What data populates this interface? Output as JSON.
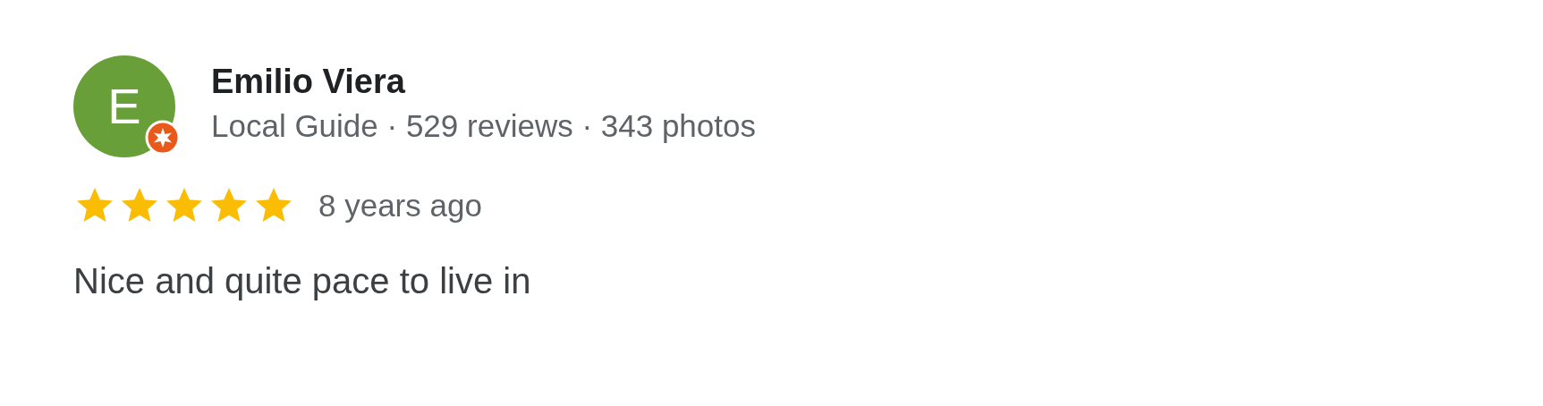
{
  "review": {
    "avatar_letter": "E",
    "name": "Emilio Viera",
    "meta": "Local Guide · 529 reviews · 343 photos",
    "local_guide": true,
    "stars": 5,
    "time": "8 years ago",
    "text": "Nice and quite pace to live in"
  }
}
